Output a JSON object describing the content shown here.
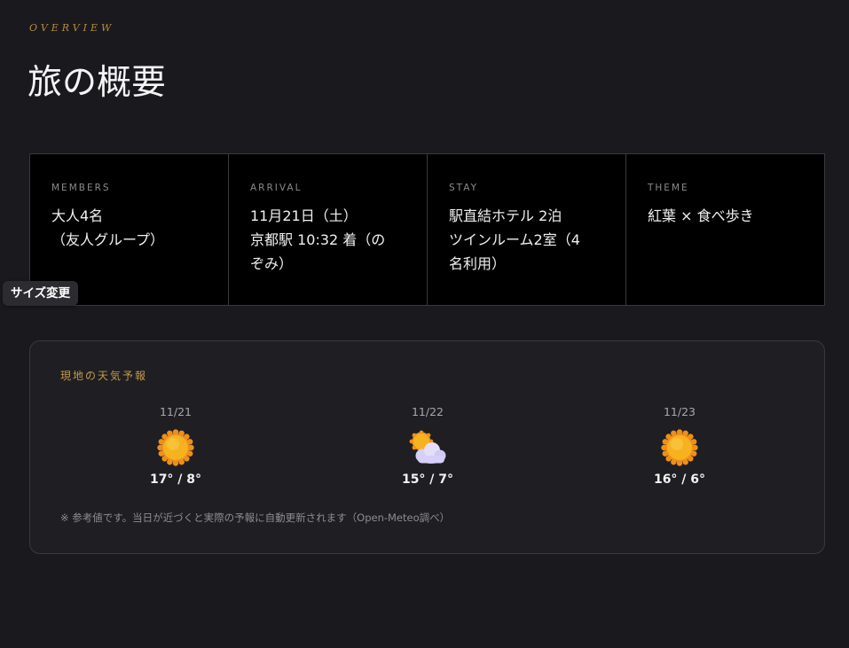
{
  "overview": {
    "eyebrow": "OVERVIEW",
    "title": "旅の概要"
  },
  "cards": [
    {
      "label": "MEMBERS",
      "value": "大人4名\n（友人グループ）"
    },
    {
      "label": "ARRIVAL",
      "value": "11月21日（土）\n京都駅 10:32 着（の\nぞみ）"
    },
    {
      "label": "STAY",
      "value": "駅直結ホテル 2泊\nツインルーム2室（4\n名利用）"
    },
    {
      "label": "THEME",
      "value": "紅葉 × 食べ歩き"
    }
  ],
  "tooltip": {
    "resize": "サイズ変更"
  },
  "weather": {
    "heading": "現地の天気予報",
    "days": [
      {
        "date": "11/21",
        "icon": "sun-icon",
        "temp": "17° / 8°"
      },
      {
        "date": "11/22",
        "icon": "sun-behind-cloud-icon",
        "temp": "15° / 7°"
      },
      {
        "date": "11/23",
        "icon": "sun-icon",
        "temp": "16° / 6°"
      }
    ],
    "note": "※ 参考値です。当日が近づくと実際の予報に自動更新されます（Open-Meteo調べ）"
  },
  "colors": {
    "accent": "#b58b3c",
    "background": "#1a191e",
    "card_background": "#000000",
    "sun": "#f6b21f"
  }
}
